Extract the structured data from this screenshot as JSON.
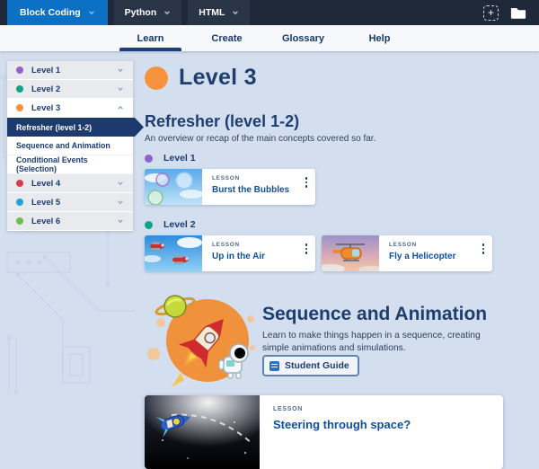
{
  "topbar": {
    "brand_tabs": [
      {
        "label": "Block Coding",
        "active": true
      },
      {
        "label": "Python",
        "active": false
      },
      {
        "label": "HTML",
        "active": false
      }
    ],
    "icons": [
      "add-project",
      "folder"
    ]
  },
  "nav": {
    "tabs": [
      {
        "label": "Learn",
        "active": true
      },
      {
        "label": "Create",
        "active": false
      },
      {
        "label": "Glossary",
        "active": false
      },
      {
        "label": "Help",
        "active": false
      }
    ]
  },
  "sidebar": {
    "levels": [
      {
        "label": "Level 1",
        "color": "#8f63cf",
        "expanded": false
      },
      {
        "label": "Level 2",
        "color": "#12a388",
        "expanded": false
      },
      {
        "label": "Level 3",
        "color": "#f5913d",
        "expanded": true
      },
      {
        "label": "Level 4",
        "color": "#d63d4d",
        "expanded": false
      },
      {
        "label": "Level 5",
        "color": "#22a2d9",
        "expanded": false
      },
      {
        "label": "Level 6",
        "color": "#6cbf4d",
        "expanded": false
      }
    ],
    "level3_items": [
      {
        "label": "Refresher (level 1-2)",
        "selected": true
      },
      {
        "label": "Sequence and Animation",
        "selected": false
      },
      {
        "label": "Conditional Events (Selection)",
        "selected": false
      }
    ]
  },
  "labels": {
    "lesson_tag": "LESSON"
  },
  "main": {
    "page_title": "Level 3",
    "page_dot_color": "#f5933e",
    "refresher": {
      "title": "Refresher (level 1-2)",
      "description": "An overview or recap of the main concepts covered so far.",
      "groups": [
        {
          "label": "Level 1",
          "color": "#8f63cf",
          "lessons": [
            {
              "title": "Burst the Bubbles"
            }
          ]
        },
        {
          "label": "Level 2",
          "color": "#12a388",
          "lessons": [
            {
              "title": "Up in the Air"
            },
            {
              "title": "Fly a Helicopter"
            }
          ]
        }
      ]
    },
    "sequence": {
      "title": "Sequence and Animation",
      "description": "Learn to make things happen in a sequence, creating simple animations and simulations.",
      "guide_button": "Student Guide",
      "lessons": [
        {
          "title": "Steering through space?"
        }
      ]
    }
  },
  "colors": {
    "topbar_bg": "#1f2939",
    "active_brand_tab": "#0c70c5",
    "nav_active_underline": "#1c3f7b",
    "selected_item_bg": "#1c3a6d",
    "page_bg": "#d3deee",
    "lesson_title": "#0d4fa0"
  }
}
